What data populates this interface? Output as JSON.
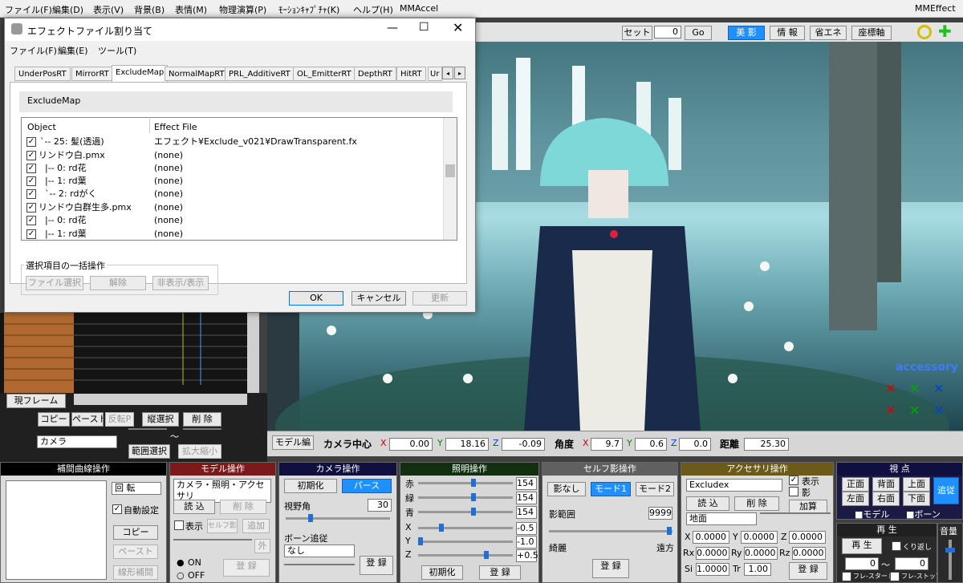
{
  "menubar": {
    "items": [
      "ファイル(F)",
      "編集(D)",
      "表示(V)",
      "背景(B)",
      "表情(M)",
      "物理演算(P)",
      "ﾓｰｼｮﾝｷｬﾌﾟﾁｬ(K)",
      "ヘルプ(H)",
      "MMAccel"
    ],
    "right": "MMEffect"
  },
  "topbar": {
    "set_label": "セット",
    "set_value": "0",
    "go": "Go",
    "bieiei": "美 影",
    "info": "情 報",
    "energy": "省エネ",
    "axis": "座標軸"
  },
  "dialog": {
    "title": "エフェクトファイル割り当て",
    "menu": [
      "ファイル(F)",
      "編集(E)",
      "ツール(T)"
    ],
    "tabs": [
      "UnderPosRT",
      "MirrorRT",
      "ExcludeMap",
      "NormalMapRT",
      "PRL_AdditiveRT",
      "OL_EmitterRT",
      "DepthRT",
      "HitRT",
      "Ur"
    ],
    "section": "ExcludeMap",
    "col_object": "Object",
    "col_effect": "Effect File",
    "rows": [
      {
        "object": "`-- 25: 髪(透過)",
        "effect": "エフェクト¥Exclude_v021¥DrawTransparent.fx"
      },
      {
        "object": "リンドウ白.pmx",
        "effect": "(none)"
      },
      {
        "object": "|-- 0: rd花",
        "effect": "(none)"
      },
      {
        "object": "|-- 1: rd葉",
        "effect": "(none)"
      },
      {
        "object": "`-- 2: rdがく",
        "effect": "(none)"
      },
      {
        "object": "リンドウ白群生多.pmx",
        "effect": "(none)"
      },
      {
        "object": "|-- 0: rd花",
        "effect": "(none)"
      },
      {
        "object": "|-- 1: rd葉",
        "effect": "(none)"
      }
    ],
    "bulk_label": "選択項目の一括操作",
    "bulk_file": "ファイル選択",
    "bulk_clear": "解除",
    "bulk_toggle": "非表示/表示",
    "ok": "OK",
    "cancel": "キャンセル",
    "update": "更新"
  },
  "left": {
    "current_frame": "現フレーム",
    "copy": "コピー",
    "paste": "ペースト",
    "reverse": "反転P",
    "vsel": "縦選択",
    "delete": "削 除",
    "camera": "カメラ",
    "range": "範囲選択",
    "scale": "拡大縮小"
  },
  "status": {
    "model_edit": "モデル編",
    "cam_center": "カメラ中心",
    "x": "0.00",
    "y": "18.16",
    "z": "-0.09",
    "angle": "角度",
    "ax": "9.7",
    "ay": "0.6",
    "az": "0.0",
    "dist": "距離",
    "dist_v": "25.30"
  },
  "viewport": {
    "accessory": "accessory"
  },
  "panels": {
    "curve": {
      "title": "補間曲線操作",
      "rot": "回 転",
      "auto": "自動設定",
      "copy": "コピー",
      "paste": "ペースト",
      "linear": "線形補間"
    },
    "model": {
      "title": "モデル操作",
      "select": "カメラ・照明・アクセサリ",
      "load": "読 込",
      "del": "削 除",
      "show": "表示",
      "self": "セルフ影",
      "add": "追加",
      "out": "外",
      "on": "ON",
      "off": "OFF",
      "reg": "登 録"
    },
    "camera": {
      "title": "カメラ操作",
      "init": "初期化",
      "pers": "パース",
      "fov": "視野角",
      "fov_v": "30",
      "bone": "ボーン追従",
      "bone_v": "なし",
      "reg": "登 録"
    },
    "light": {
      "title": "照明操作",
      "r": "赤",
      "g": "緑",
      "b": "青",
      "rv": "154",
      "gv": "154",
      "bv": "154",
      "x": "X",
      "y": "Y",
      "z": "Z",
      "xv": "-0.5",
      "yv": "-1.0",
      "zv": "+0.5",
      "init": "初期化",
      "reg": "登 録"
    },
    "shadow": {
      "title": "セルフ影操作",
      "none": "影なし",
      "m1": "モード1",
      "m2": "モード2",
      "range": "影範囲",
      "range_v": "9999",
      "near": "綺麗",
      "far": "遠方",
      "reg": "登 録"
    },
    "acc": {
      "title": "アクセサリ操作",
      "select": "Excludex",
      "show": "表示",
      "shadow": "影",
      "load": "読 込",
      "del": "削 除",
      "add": "加算",
      "ground": "地面",
      "x": "0.0000",
      "y": "0.0000",
      "z": "0.0000",
      "rx": "0.0000",
      "ry": "0.0000",
      "rz": "0.0000",
      "si": "1.0000",
      "tr": "1.00",
      "reg": "登 録"
    },
    "view": {
      "title": "視 点",
      "front": "正面",
      "back": "背面",
      "top": "上面",
      "left": "左面",
      "right": "右面",
      "bottom": "下面",
      "follow": "追従",
      "model": "■モデル",
      "bone": "■ボーン"
    },
    "play": {
      "title": "再 生",
      "play": "再 生",
      "repeat": "くり返し",
      "from": "0",
      "to": "0",
      "fstart": "フレ-スタート",
      "fstop": "フレ-ストップ",
      "vol": "音量"
    }
  },
  "colors": {
    "curve": "#000000",
    "model": "#7a1a1a",
    "camera": "#101040",
    "light": "#103010",
    "shadow": "#606060",
    "acc": "#6b5a1a",
    "view": "#101040",
    "play": "#202020"
  }
}
